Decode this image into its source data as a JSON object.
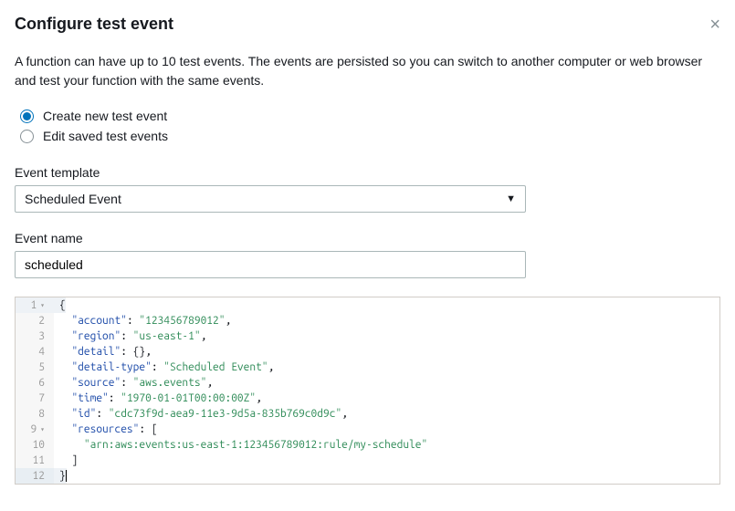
{
  "header": {
    "title": "Configure test event"
  },
  "description": "A function can have up to 10 test events. The events are persisted so you can switch to another computer or web browser and test your function with the same events.",
  "mode": {
    "create_label": "Create new test event",
    "edit_label": "Edit saved test events",
    "selected": "create"
  },
  "template": {
    "label": "Event template",
    "value": "Scheduled Event"
  },
  "event_name": {
    "label": "Event name",
    "value": "scheduled"
  },
  "editor": {
    "lines": [
      {
        "n": "1",
        "fold": true,
        "tokens": [
          {
            "t": "{",
            "c": "pun"
          }
        ]
      },
      {
        "n": "2",
        "tokens": [
          {
            "t": "  ",
            "c": "pun"
          },
          {
            "t": "\"account\"",
            "c": "key"
          },
          {
            "t": ": ",
            "c": "pun"
          },
          {
            "t": "\"123456789012\"",
            "c": "str"
          },
          {
            "t": ",",
            "c": "pun"
          }
        ]
      },
      {
        "n": "3",
        "tokens": [
          {
            "t": "  ",
            "c": "pun"
          },
          {
            "t": "\"region\"",
            "c": "key"
          },
          {
            "t": ": ",
            "c": "pun"
          },
          {
            "t": "\"us-east-1\"",
            "c": "str"
          },
          {
            "t": ",",
            "c": "pun"
          }
        ]
      },
      {
        "n": "4",
        "tokens": [
          {
            "t": "  ",
            "c": "pun"
          },
          {
            "t": "\"detail\"",
            "c": "key"
          },
          {
            "t": ": {},",
            "c": "pun"
          }
        ]
      },
      {
        "n": "5",
        "tokens": [
          {
            "t": "  ",
            "c": "pun"
          },
          {
            "t": "\"detail-type\"",
            "c": "key"
          },
          {
            "t": ": ",
            "c": "pun"
          },
          {
            "t": "\"Scheduled Event\"",
            "c": "str"
          },
          {
            "t": ",",
            "c": "pun"
          }
        ]
      },
      {
        "n": "6",
        "tokens": [
          {
            "t": "  ",
            "c": "pun"
          },
          {
            "t": "\"source\"",
            "c": "key"
          },
          {
            "t": ": ",
            "c": "pun"
          },
          {
            "t": "\"aws.events\"",
            "c": "str"
          },
          {
            "t": ",",
            "c": "pun"
          }
        ]
      },
      {
        "n": "7",
        "tokens": [
          {
            "t": "  ",
            "c": "pun"
          },
          {
            "t": "\"time\"",
            "c": "key"
          },
          {
            "t": ": ",
            "c": "pun"
          },
          {
            "t": "\"1970-01-01T00:00:00Z\"",
            "c": "str"
          },
          {
            "t": ",",
            "c": "pun"
          }
        ]
      },
      {
        "n": "8",
        "tokens": [
          {
            "t": "  ",
            "c": "pun"
          },
          {
            "t": "\"id\"",
            "c": "key"
          },
          {
            "t": ": ",
            "c": "pun"
          },
          {
            "t": "\"cdc73f9d-aea9-11e3-9d5a-835b769c0d9c\"",
            "c": "str"
          },
          {
            "t": ",",
            "c": "pun"
          }
        ]
      },
      {
        "n": "9",
        "fold": true,
        "tokens": [
          {
            "t": "  ",
            "c": "pun"
          },
          {
            "t": "\"resources\"",
            "c": "key"
          },
          {
            "t": ": [",
            "c": "pun"
          }
        ]
      },
      {
        "n": "10",
        "tokens": [
          {
            "t": "    ",
            "c": "pun"
          },
          {
            "t": "\"arn:aws:events:us-east-1:123456789012:rule/my-schedule\"",
            "c": "str"
          }
        ]
      },
      {
        "n": "11",
        "tokens": [
          {
            "t": "  ]",
            "c": "pun"
          }
        ]
      },
      {
        "n": "12",
        "hl": true,
        "cursor": true,
        "tokens": [
          {
            "t": "}",
            "c": "pun"
          }
        ]
      }
    ]
  }
}
